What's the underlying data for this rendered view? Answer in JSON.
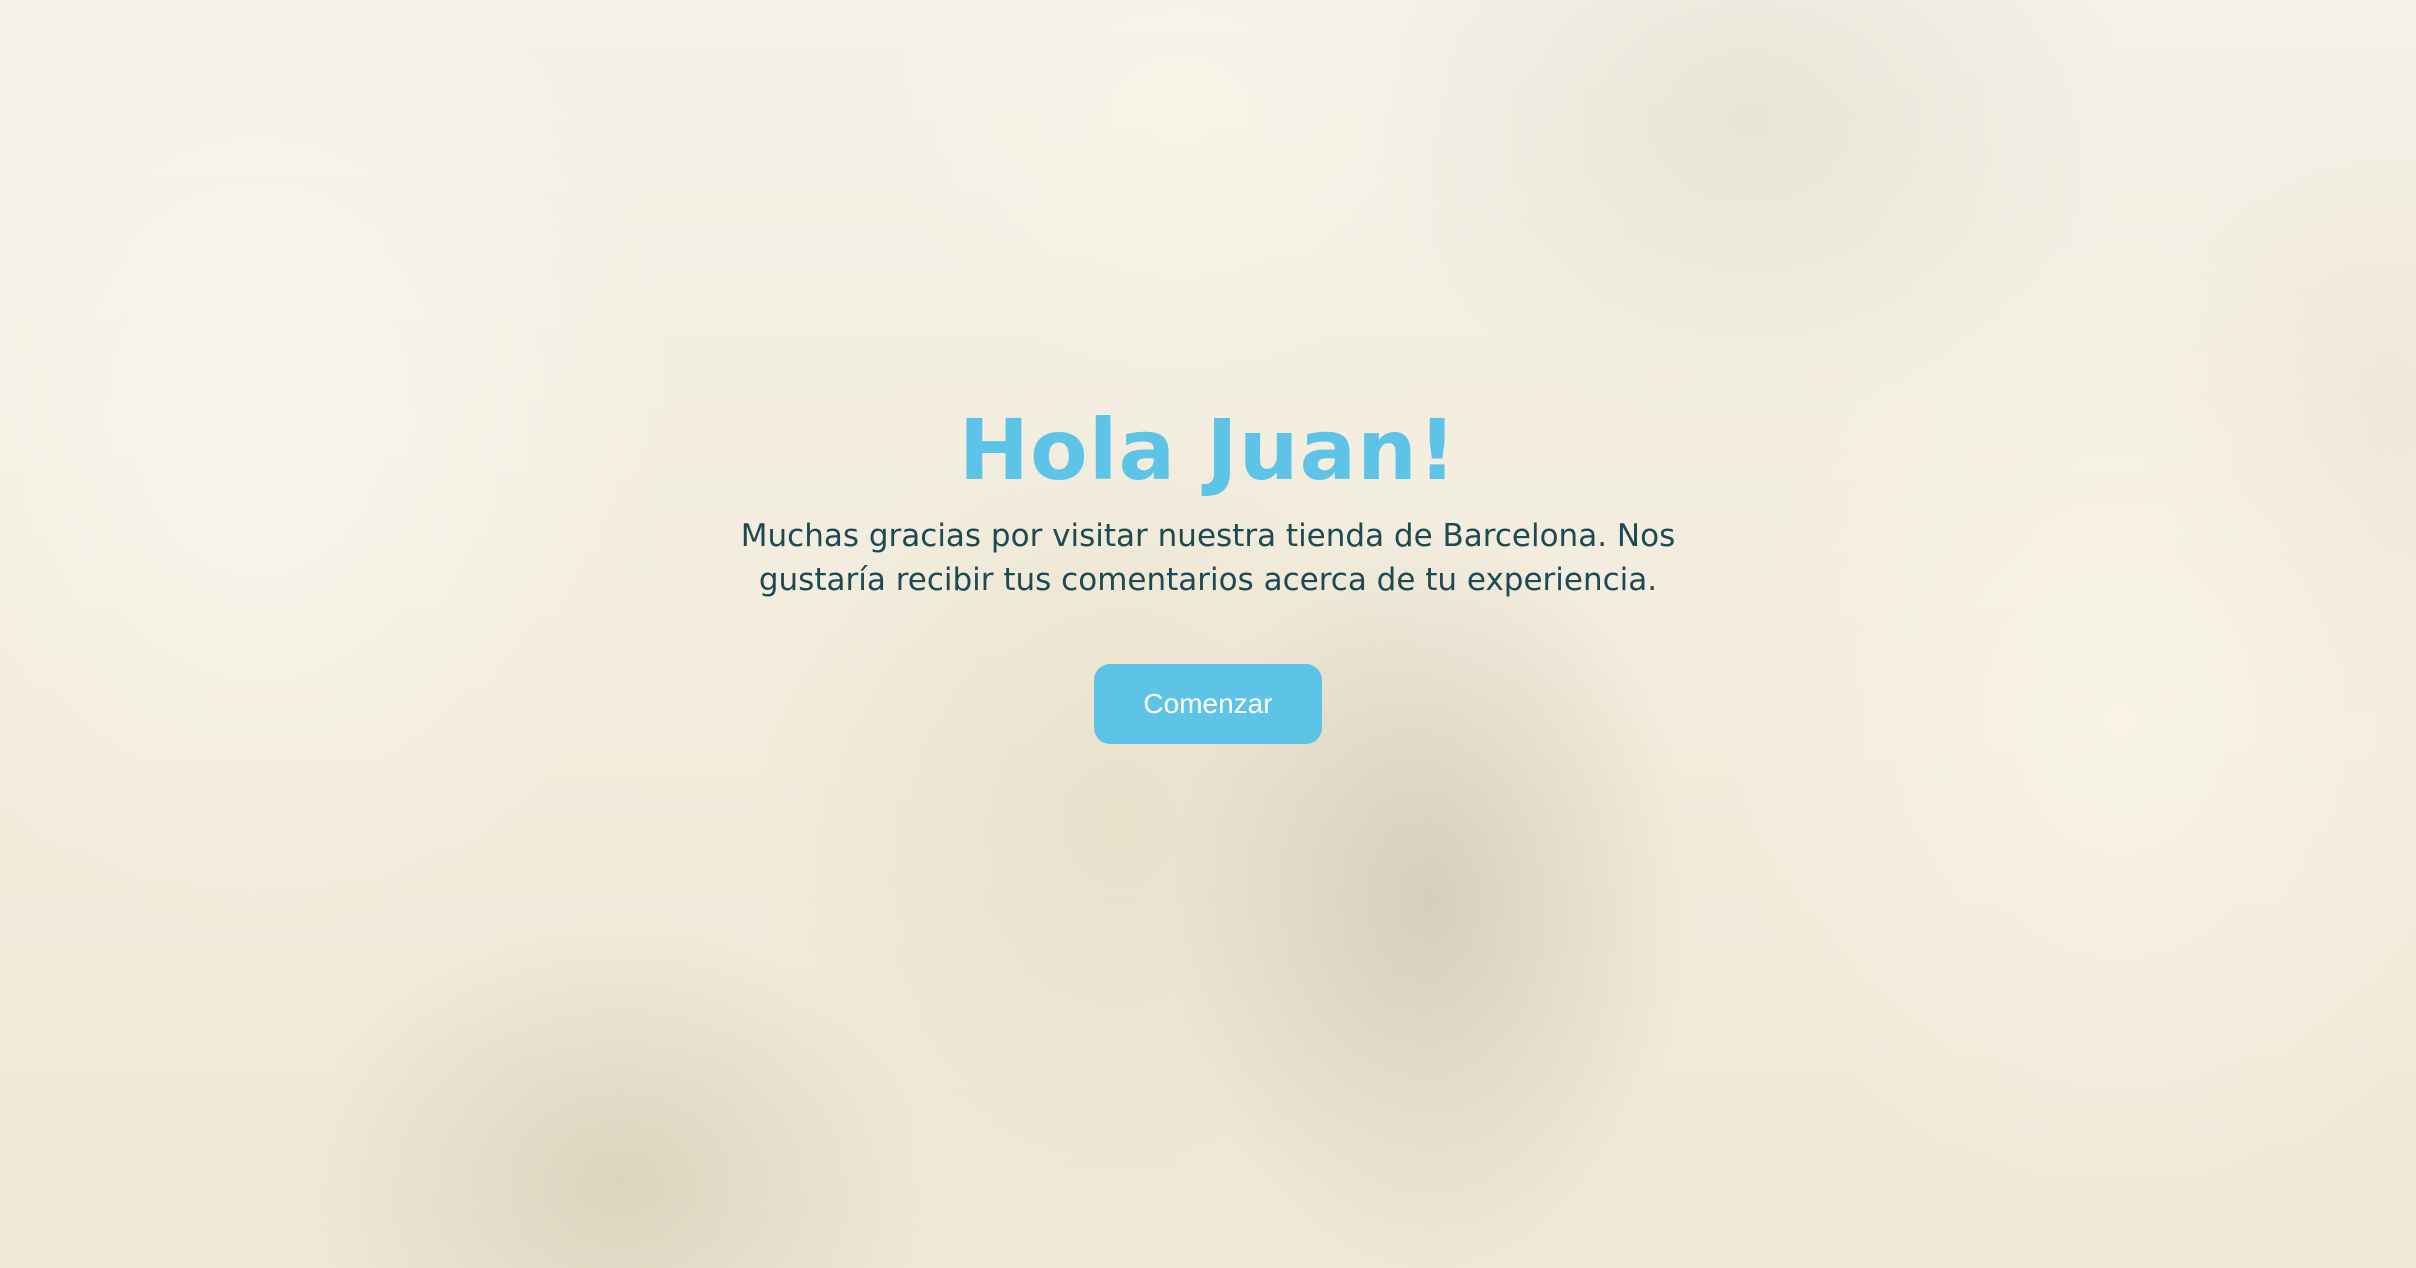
{
  "welcome": {
    "title": "Hola Juan!",
    "message": "Muchas gracias por visitar nuestra tienda de Barcelona. Nos gustaría recibir tus comentarios acerca de tu experiencia.",
    "start_button_label": "Comenzar"
  },
  "colors": {
    "accent": "#5ec4e7",
    "text": "#1d4a52",
    "background": "#f3efe3"
  }
}
